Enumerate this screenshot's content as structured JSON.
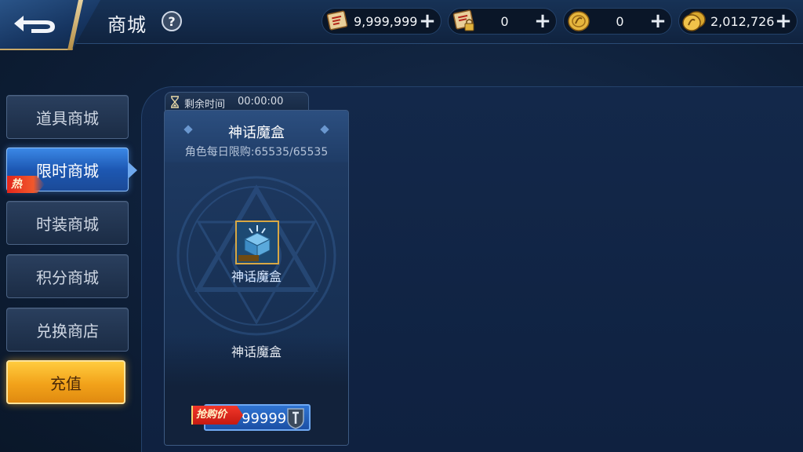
{
  "header": {
    "title": "商城",
    "help_symbol": "?"
  },
  "currencies": [
    {
      "icon": "scroll-icon",
      "value": "9,999,999",
      "plus": "+"
    },
    {
      "icon": "locked-scroll-icon",
      "value": "0",
      "plus": "+"
    },
    {
      "icon": "coin-icon",
      "value": "0",
      "plus": "+"
    },
    {
      "icon": "gold-coins-icon",
      "value": "2,012,726",
      "plus": "+"
    }
  ],
  "sidebar": {
    "items": [
      {
        "label": "道具商城",
        "active": false
      },
      {
        "label": "限时商城",
        "active": true
      },
      {
        "label": "时装商城",
        "active": false
      },
      {
        "label": "积分商城",
        "active": false
      },
      {
        "label": "兑换商店",
        "active": false
      }
    ],
    "hot_tag": "热",
    "recharge": "充值"
  },
  "timer": {
    "label": "剩余时间",
    "value": "00:00:00"
  },
  "card": {
    "title": "神话魔盒",
    "limit": "角色每日限购:65535/65535",
    "item_name": "神话魔盒",
    "description": "神话魔盒",
    "sale_tag": "抢购价",
    "price": "99999"
  },
  "colors": {
    "active_tab": "#2a6fd0",
    "recharge": "#f2a21a",
    "sale_tag": "#e0261a"
  }
}
